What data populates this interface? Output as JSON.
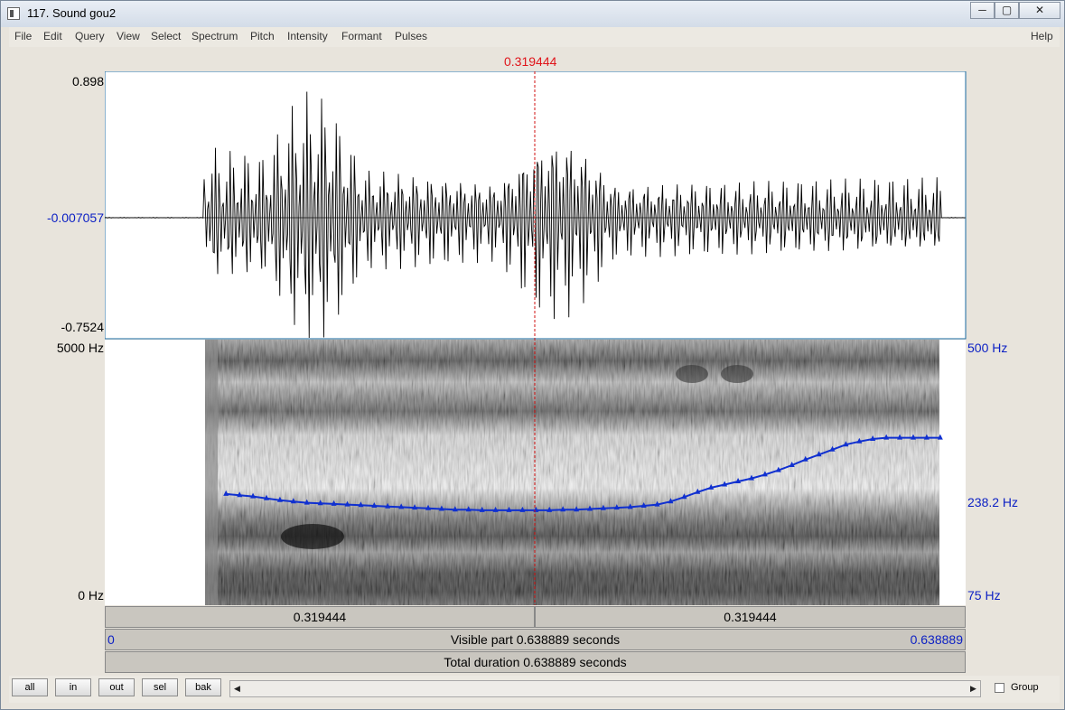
{
  "window": {
    "title": "117. Sound gou2"
  },
  "menu": [
    "File",
    "Edit",
    "Query",
    "View",
    "Select",
    "Spectrum",
    "Pitch",
    "Intensity",
    "Formant",
    "Pulses"
  ],
  "help_label": "Help",
  "cursor": {
    "time_label": "0.319444",
    "time_seconds": 0.319444
  },
  "waveform": {
    "max_label": "0.898",
    "mid_label": "-0.007057",
    "min_label": "-0.7524"
  },
  "spectrogram": {
    "top_label": "5000 Hz",
    "bottom_label": "0 Hz"
  },
  "pitch_axis": {
    "top_label": "500 Hz",
    "mid_label": "238.2 Hz",
    "bottom_label": "75 Hz"
  },
  "pitch_track": {
    "color": "#1030d0",
    "times": [
      0.09,
      0.1,
      0.11,
      0.12,
      0.13,
      0.14,
      0.15,
      0.16,
      0.17,
      0.18,
      0.19,
      0.2,
      0.21,
      0.22,
      0.23,
      0.24,
      0.25,
      0.26,
      0.27,
      0.28,
      0.29,
      0.3,
      0.31,
      0.32,
      0.33,
      0.34,
      0.35,
      0.36,
      0.37,
      0.38,
      0.39,
      0.4,
      0.41,
      0.42,
      0.43,
      0.44,
      0.45,
      0.46,
      0.47,
      0.48,
      0.49,
      0.5,
      0.51,
      0.52,
      0.53,
      0.54,
      0.55,
      0.56,
      0.57,
      0.58,
      0.59,
      0.6,
      0.61,
      0.62
    ],
    "values_hz": [
      253,
      251,
      249,
      246,
      243,
      241,
      239,
      238,
      237,
      236,
      235,
      234,
      233,
      232,
      231,
      230,
      229,
      228,
      228,
      227,
      227,
      227,
      227,
      227,
      227,
      228,
      228,
      229,
      230,
      231,
      232,
      234,
      236,
      241,
      248,
      256,
      263,
      268,
      273,
      278,
      284,
      291,
      299,
      308,
      316,
      324,
      332,
      337,
      341,
      343,
      343,
      343,
      343,
      343
    ]
  },
  "time_ruler": {
    "left_label": "0.319444",
    "right_label": "0.319444"
  },
  "visible_part": {
    "start_label": "0",
    "text": "Visible part 0.638889 seconds",
    "end_label": "0.638889"
  },
  "total_duration": {
    "text": "Total duration 0.638889 seconds"
  },
  "buttons": [
    "all",
    "in",
    "out",
    "sel",
    "bak"
  ],
  "group_label": "Group",
  "colors": {
    "accent_blue": "#0b1fc4",
    "cursor_red": "#e0151b"
  }
}
